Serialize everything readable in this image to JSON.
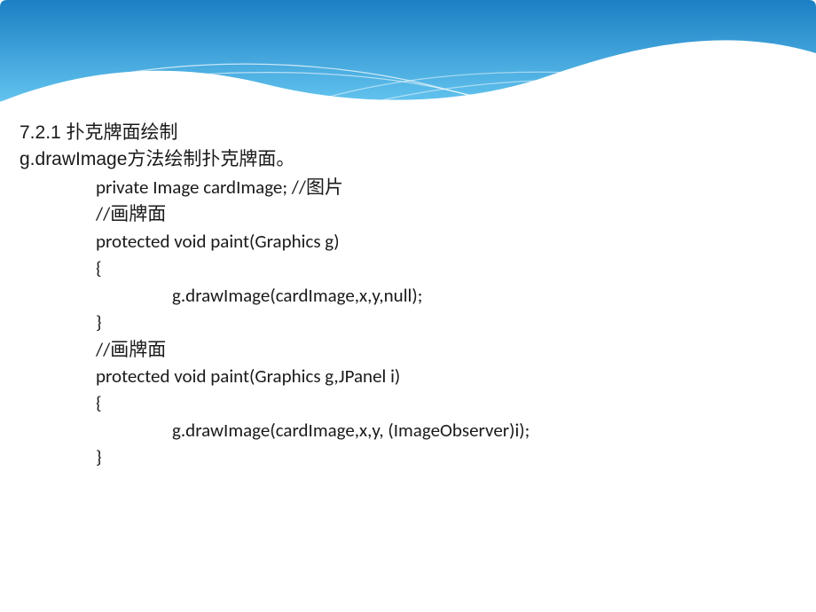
{
  "heading": "7.2.1  扑克牌面绘制",
  "method_desc": "g.drawImage方法绘制扑克牌面。",
  "code": {
    "l1": "private Image cardImage; //图片",
    "l2": "//画牌面",
    "l3": "protected void paint(Graphics g)",
    "l4": "{",
    "l5": "g.drawImage(cardImage,x,y,null);",
    "l6": "}",
    "l7": "//画牌面",
    "l8": "protected void paint(Graphics g,JPanel i)",
    "l9": "{",
    "l10": "g.drawImage(cardImage,x,y, (ImageObserver)i);",
    "l11_blank": "",
    "l12": "}"
  }
}
